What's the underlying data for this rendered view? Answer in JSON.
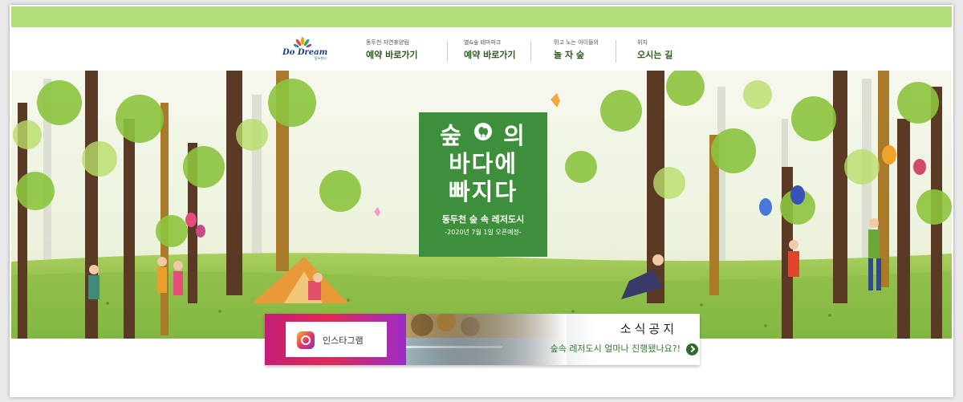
{
  "logo": {
    "text": "Do Dream",
    "sub": "동두천시"
  },
  "nav": [
    {
      "small": "동두천 자연휴양림",
      "label": "예약 바로가기"
    },
    {
      "small": "별&숲 테마파크",
      "label": "예약 바로가기"
    },
    {
      "small": "뛰고 노는 아이들의",
      "label": "놀 자 숲"
    },
    {
      "small": "위치",
      "label": "오시는 길"
    }
  ],
  "hero": {
    "line1a": "숲",
    "line1b": "의",
    "line2": "바다에",
    "line3": "빠지다",
    "sub": "동두천 숲 속 레저도시",
    "date": "-2020년 7월 1일 오픈예정-"
  },
  "instagram": {
    "label": "인스타그램"
  },
  "notice": {
    "title": "소식공지",
    "desc": "숲속 레저도시 얼마나 진행됐나요?!"
  },
  "colors": {
    "topbar": "#b3de7c",
    "headline_bg": "#3e8f3b",
    "nav_text": "#2d5a1e",
    "notice_text": "#2f7f2c"
  }
}
